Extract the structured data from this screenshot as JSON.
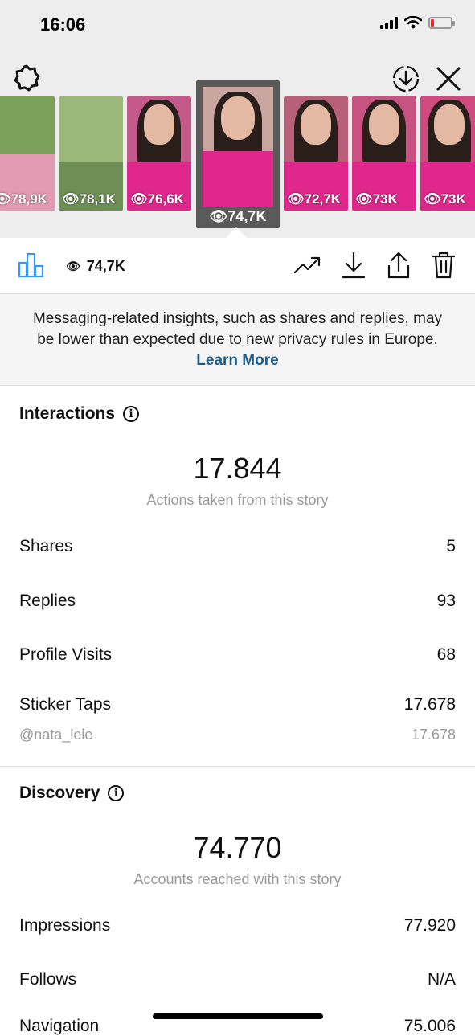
{
  "status": {
    "time": "16:06"
  },
  "stories": [
    {
      "views": "78,9K",
      "bg": "#7aa05a"
    },
    {
      "views": "78,1K",
      "bg": "#9bb87a"
    },
    {
      "views": "76,6K",
      "bg": "#c45a8a"
    },
    {
      "views": "72,7K",
      "bg": "#b8607a"
    },
    {
      "views": "73K",
      "bg": "#c75383"
    },
    {
      "views": "73K",
      "bg": "#cf4a7e"
    }
  ],
  "selected_story": {
    "views": "74,7K"
  },
  "toolbar": {
    "views": "74,7K"
  },
  "notice": {
    "text": "Messaging-related insights, such as shares and replies, may be lower than expected due to new privacy rules in Europe.",
    "link": "Learn More"
  },
  "interactions": {
    "title": "Interactions",
    "total": "17.844",
    "subtitle": "Actions taken from this story",
    "rows": [
      {
        "label": "Shares",
        "value": "5"
      },
      {
        "label": "Replies",
        "value": "93"
      },
      {
        "label": "Profile Visits",
        "value": "68"
      },
      {
        "label": "Sticker Taps",
        "value": "17.678"
      }
    ],
    "sticker_row": {
      "label": "@nata_lele",
      "value": "17.678"
    }
  },
  "discovery": {
    "title": "Discovery",
    "total": "74.770",
    "subtitle": "Accounts reached with this story",
    "rows": [
      {
        "label": "Impressions",
        "value": "77.920"
      },
      {
        "label": "Follows",
        "value": "N/A"
      },
      {
        "label": "Navigation",
        "value": "75.006"
      }
    ]
  },
  "colors": {
    "accent_blue": "#3897f0",
    "link_blue": "#1f5b8a",
    "muted_gray": "#999999"
  }
}
